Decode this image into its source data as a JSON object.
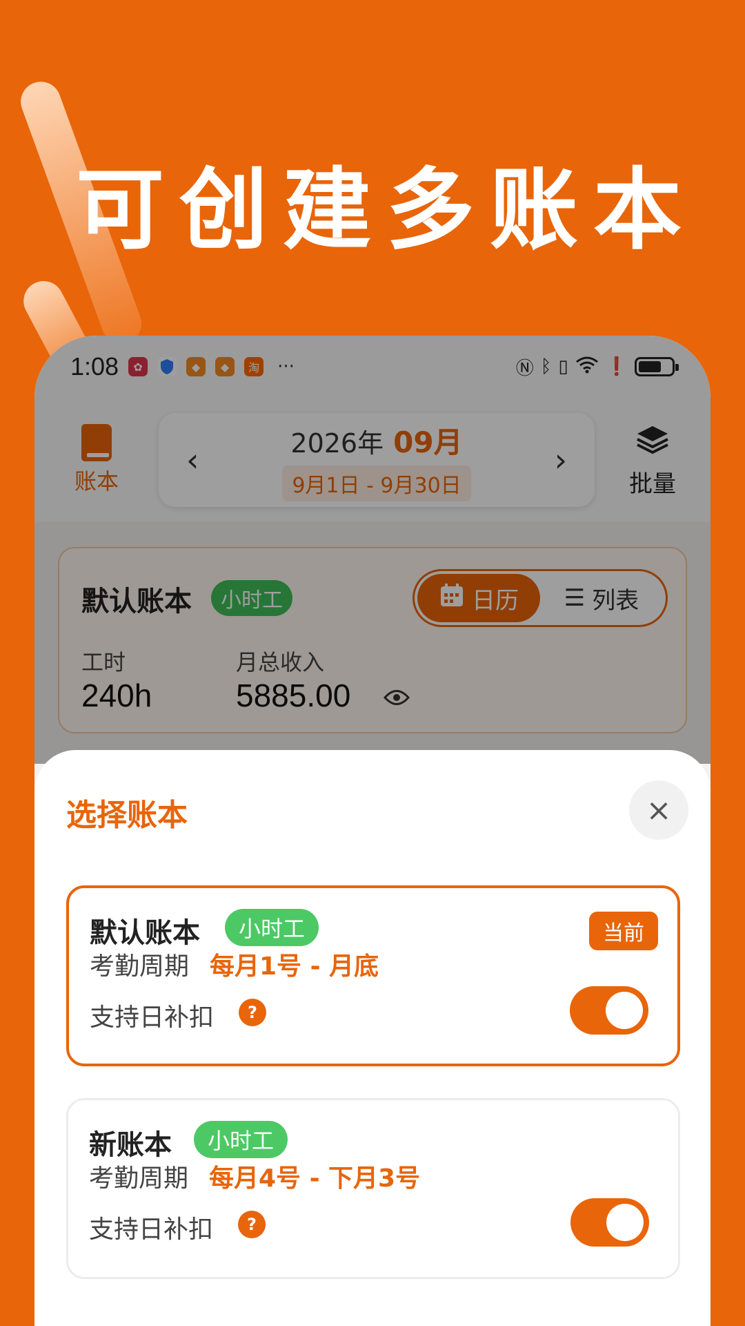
{
  "promo": {
    "headline": "可创建多账本"
  },
  "status_bar": {
    "time": "1:08",
    "notification_icons": [
      "huawei-icon",
      "shield-icon",
      "app-icon",
      "app-icon",
      "taobao-icon"
    ],
    "taobao_glyph": "淘",
    "more": "···",
    "right_icons": [
      "nfc-icon",
      "bluetooth-icon",
      "vibrate-icon",
      "wifi-icon",
      "alert-icon",
      "battery-icon"
    ]
  },
  "top_bar": {
    "book_label": "账本",
    "year": "2026年",
    "month": "09月",
    "range": "9月1日 - 9月30日",
    "prev": "‹",
    "next": "›",
    "batch_label": "批量"
  },
  "summary": {
    "book_name": "默认账本",
    "type_tag": "小时工",
    "toggle_calendar": "日历",
    "toggle_list": "列表",
    "hours_label": "工时",
    "hours_value": "240h",
    "income_label": "月总收入",
    "income_value": "5885.00"
  },
  "sheet": {
    "title": "选择账本",
    "close": "×",
    "books": [
      {
        "name": "默认账本",
        "tag": "小时工",
        "badge": "当前",
        "period_label": "考勤周期",
        "period_value": "每月1号 - 月底",
        "support_label": "支持日补扣",
        "help": "?",
        "toggle_on": true
      },
      {
        "name": "新账本",
        "tag": "小时工",
        "period_label": "考勤周期",
        "period_value": "每月4号 - 下月3号",
        "support_label": "支持日补扣",
        "help": "?",
        "toggle_on": true
      }
    ]
  },
  "colors": {
    "brand": "#E8650A",
    "tag_green": "#4cc964",
    "bg": "#E8650A"
  }
}
